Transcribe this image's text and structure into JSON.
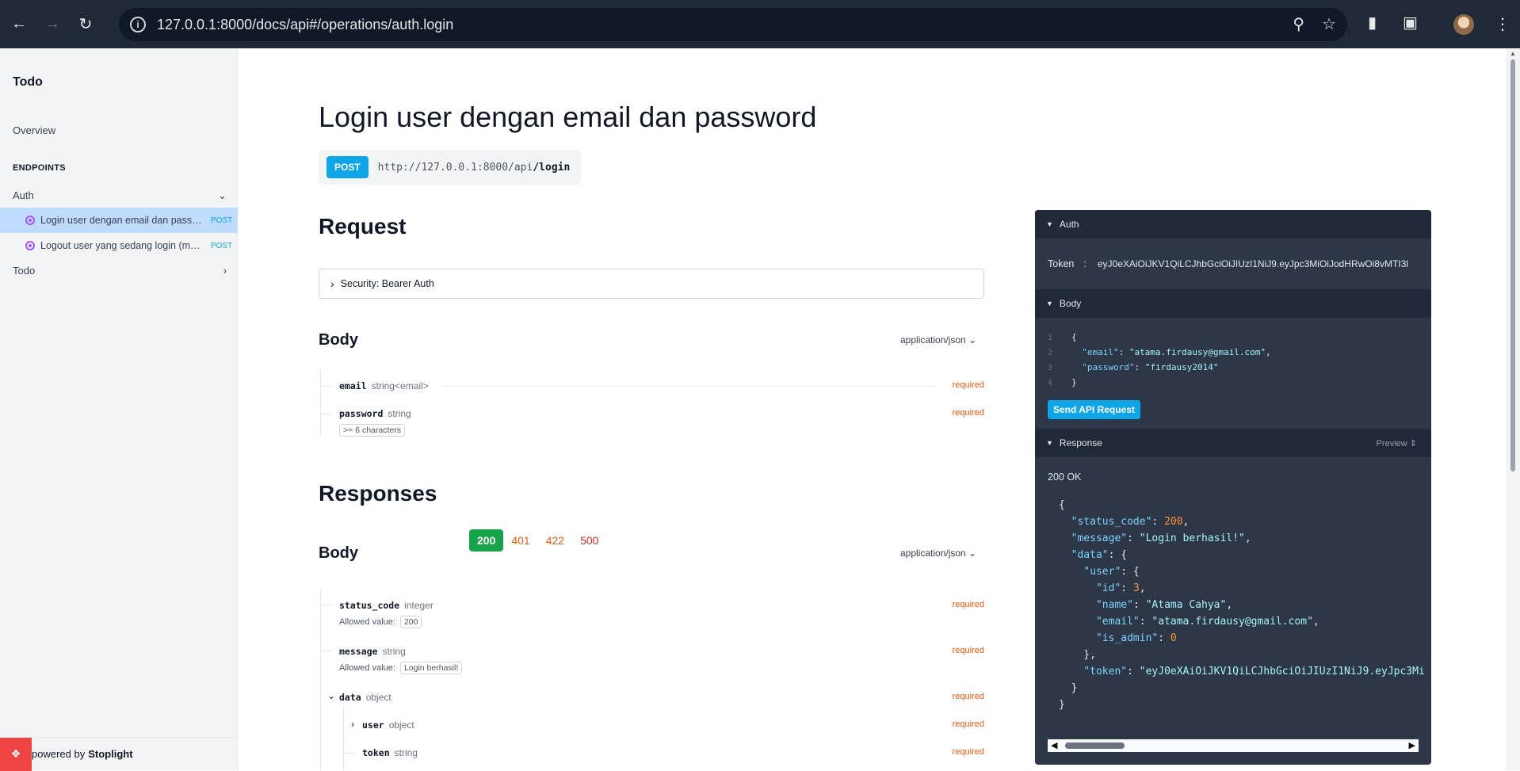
{
  "browser": {
    "url": "127.0.0.1:8000/docs/api#/operations/auth.login",
    "back_icon": "arrow-left-icon",
    "forward_icon": "arrow-right-icon",
    "reload_icon": "reload-icon"
  },
  "sidebar": {
    "title": "Todo",
    "overview": "Overview",
    "endpoints_heading": "ENDPOINTS",
    "groups": [
      {
        "label": "Auth",
        "expanded": true
      },
      {
        "label": "Todo",
        "expanded": false
      }
    ],
    "items": [
      {
        "label": "Login user dengan email dan password",
        "method": "POST",
        "active": true
      },
      {
        "label": "Logout user yang sedang login (menghapus token)",
        "method": "POST",
        "active": false
      }
    ],
    "footer_prefix": "powered by",
    "footer_brand": "Stoplight"
  },
  "main": {
    "title": "Login user dengan email dan password",
    "method": "POST",
    "url_base": "http://127.0.0.1:8000/api",
    "url_path": "/login",
    "request_heading": "Request",
    "security_label": "Security: Bearer Auth",
    "body_heading": "Body",
    "content_type": "application/json",
    "request_fields": [
      {
        "name": "email",
        "type": "string<email>",
        "required": "required"
      },
      {
        "name": "password",
        "type": "string",
        "required": "required",
        "constraint": ">= 6 characters"
      }
    ],
    "responses_heading": "Responses",
    "response_codes": [
      "200",
      "401",
      "422",
      "500"
    ],
    "response_body_heading": "Body",
    "response_fields": [
      {
        "name": "status_code",
        "type": "integer",
        "required": "required",
        "allowed_label": "Allowed value:",
        "allowed": "200"
      },
      {
        "name": "message",
        "type": "string",
        "required": "required",
        "allowed_label": "Allowed value:",
        "allowed": "Login berhasil!"
      },
      {
        "name": "data",
        "type": "object",
        "required": "required"
      },
      {
        "name": "user",
        "type": "object",
        "required": "required"
      },
      {
        "name": "token",
        "type": "string",
        "required": "required"
      }
    ]
  },
  "panel": {
    "auth_label": "Auth",
    "token_label": "Token",
    "token_value": "eyJ0eXAiOiJKV1QiLCJhbGciOiJIUzI1NiJ9.eyJpc3MiOiJodHRwOi8vMTI3l",
    "body_label": "Body",
    "body_lines": [
      "1",
      "2",
      "3",
      "4"
    ],
    "body_email_key": "\"email\"",
    "body_email_val": "\"atama.firdausy@gmail.com\"",
    "body_password_key": "\"password\"",
    "body_password_val": "\"firdausy2014\"",
    "send_label": "Send API Request",
    "response_label": "Response",
    "preview_label": "Preview",
    "status": "200 OK",
    "resp": {
      "status_code_key": "\"status_code\"",
      "status_code_val": "200",
      "message_key": "\"message\"",
      "message_val": "\"Login berhasil!\"",
      "data_key": "\"data\"",
      "user_key": "\"user\"",
      "id_key": "\"id\"",
      "id_val": "3",
      "name_key": "\"name\"",
      "name_val": "\"Atama Cahya\"",
      "email_key": "\"email\"",
      "email_val": "\"atama.firdausy@gmail.com\"",
      "is_admin_key": "\"is_admin\"",
      "is_admin_val": "0",
      "token_key": "\"token\"",
      "token_val": "\"eyJ0eXAiOiJKV1QiLCJhbGciOiJIUzI1NiJ9.eyJpc3Mi"
    }
  }
}
